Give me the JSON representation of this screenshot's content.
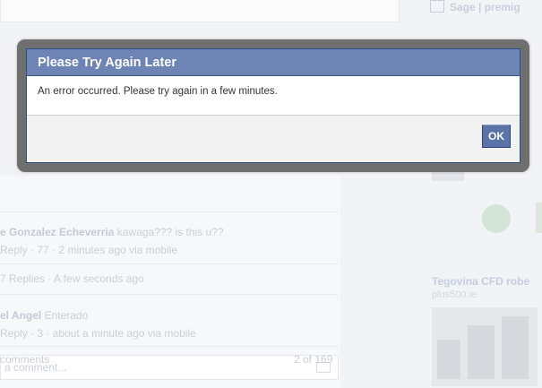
{
  "dialog": {
    "title": "Please Try Again Later",
    "message": "An error occurred. Please try again in a few minutes.",
    "ok_label": "OK"
  },
  "background": {
    "comment_placeholder": "a comment...",
    "comments": [
      {
        "author": "e Gonzalez Echeverria",
        "text": "kawaga??? is this u??",
        "meta": "Reply · 77 · 2 minutes ago via mobile",
        "replies": "7 Replies · A few seconds ago"
      },
      {
        "author": "el Angel",
        "text": "Enterado",
        "meta": "Reply · 3 · about a minute ago via mobile"
      }
    ],
    "more_comments": "comments",
    "pager": "2 of 169",
    "sidebar": {
      "header": "Sage | premig",
      "ad_title": "Tegovina CFD robe",
      "ad_url": "plus500.ie"
    }
  },
  "colors": {
    "title_bar": "#6d84b4",
    "ok_button": "#5b74a8",
    "frame": "#6f6f6f"
  }
}
